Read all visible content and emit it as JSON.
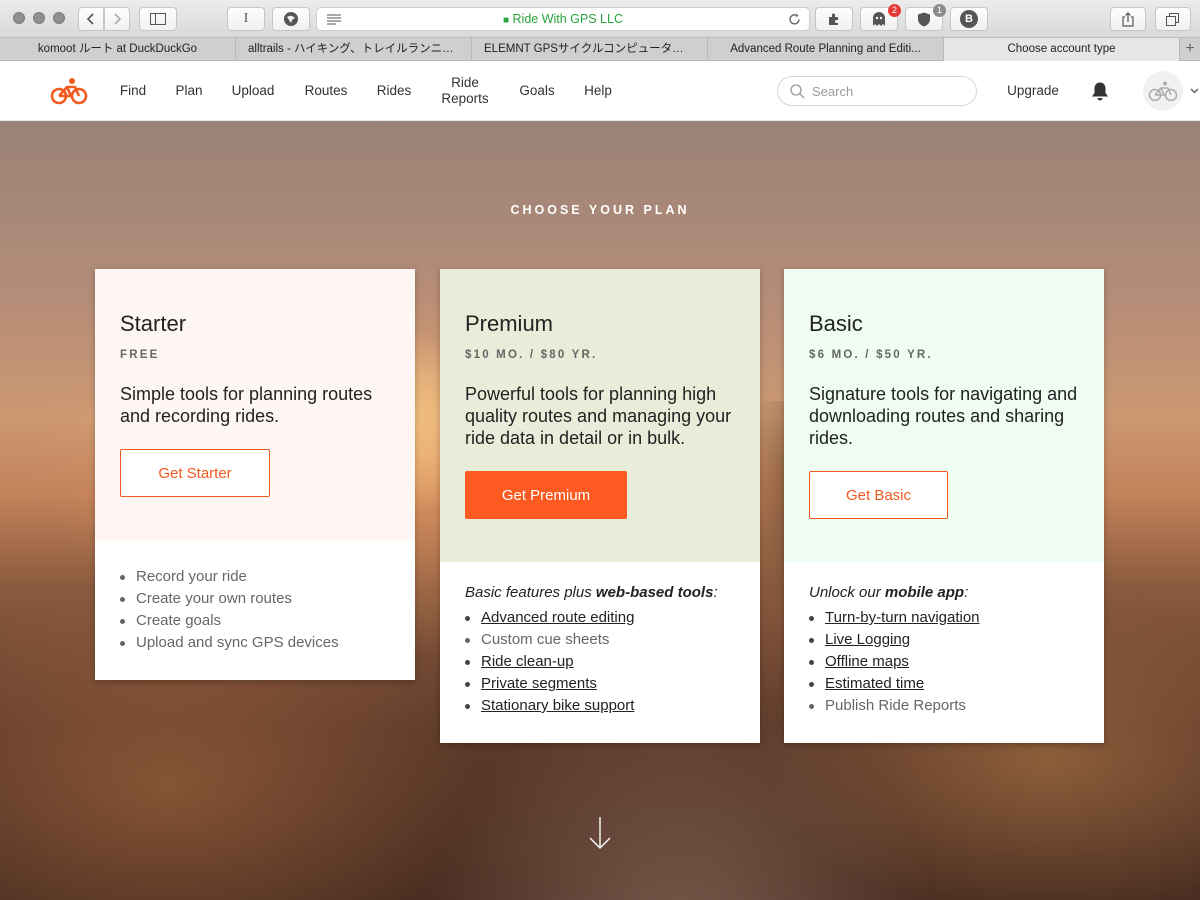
{
  "browser": {
    "url_label": "Ride With GPS LLC",
    "extension_badges": [
      "2",
      "1"
    ],
    "tabs": [
      "komoot ルート at DuckDuckGo",
      "alltrails - ハイキング、トレイルランニング...",
      "ELEMNT GPSサイクルコンピュータとRi...",
      "Advanced Route Planning and Editi...",
      "Choose account type"
    ]
  },
  "header": {
    "nav": [
      {
        "line1": "Find",
        "line2": ""
      },
      {
        "line1": "Plan",
        "line2": ""
      },
      {
        "line1": "Upload",
        "line2": ""
      },
      {
        "line1": "Routes",
        "line2": ""
      },
      {
        "line1": "Rides",
        "line2": ""
      },
      {
        "line1": "Ride",
        "line2": "Reports"
      },
      {
        "line1": "Goals",
        "line2": ""
      },
      {
        "line1": "Help",
        "line2": ""
      }
    ],
    "search_placeholder": "Search",
    "upgrade_label": "Upgrade"
  },
  "hero": {
    "title": "CHOOSE YOUR PLAN"
  },
  "plans": [
    {
      "name": "Starter",
      "price": "FREE",
      "description": "Simple tools for planning routes and recording rides.",
      "cta": "Get Starter",
      "features_intro_pre": "",
      "features_intro_bold": "",
      "features_intro_post": "",
      "features": [
        "Record your ride",
        "Create your own routes",
        "Create goals",
        "Upload and sync GPS devices"
      ]
    },
    {
      "name": "Premium",
      "price": "$10 MO. / $80 YR.",
      "description": "Powerful tools for planning high quality routes and managing your ride data in detail or in bulk.",
      "cta": "Get Premium",
      "features_intro_pre": "Basic features plus ",
      "features_intro_bold": "web-based tools",
      "features_intro_post": ":",
      "features": [
        "Advanced route editing",
        "Custom cue sheets",
        "Ride clean-up",
        "Private segments",
        "Stationary bike support"
      ]
    },
    {
      "name": "Basic",
      "price": "$6 MO. / $50 YR.",
      "description": "Signature tools for navigating and downloading routes and sharing rides.",
      "cta": "Get Basic",
      "features_intro_pre": "Unlock our ",
      "features_intro_bold": "mobile app",
      "features_intro_post": ":",
      "features": [
        "Turn-by-turn navigation",
        "Live Logging",
        "Offline maps",
        "Estimated time",
        "Publish Ride Reports"
      ]
    }
  ],
  "colors": {
    "brand_orange": "#fc5a20",
    "url_secure_green": "#2aa33c",
    "starter_card_bg": "#fdf6f3",
    "premium_card_bg": "#e9ecd9",
    "basic_card_bg": "#eefcf2"
  },
  "icons": {
    "logo": "bicycle-logo",
    "search": "magnifier-icon",
    "notifications": "bell-icon",
    "avatar": "bicycle-avatar",
    "scroll": "down-arrow-icon"
  }
}
